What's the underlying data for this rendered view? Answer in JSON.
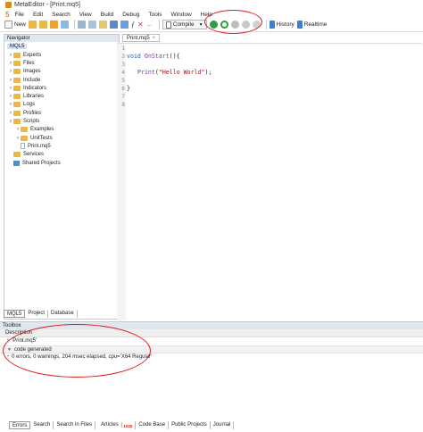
{
  "window": {
    "title": "MetaEditor - [Print.mq5]"
  },
  "menu": {
    "logo": "5",
    "items": [
      "File",
      "Edit",
      "Search",
      "View",
      "Build",
      "Debug",
      "Tools",
      "Window",
      "Help"
    ]
  },
  "toolbar": {
    "new_label": "New",
    "compile_label": "Compile",
    "history_label": "History",
    "realtime_label": "Realtime"
  },
  "navigator": {
    "title": "Navigator",
    "root": "MQL5",
    "items": [
      "Experts",
      "Files",
      "Images",
      "Include",
      "Indicators",
      "Libraries",
      "Logs",
      "Profiles",
      "Scripts",
      "Examples",
      "UnitTests",
      "Print.mq5",
      "Services",
      "Shared Projects"
    ],
    "tabs": [
      "MQL5",
      "Project",
      "Database"
    ]
  },
  "editor": {
    "tab": "Print.mq5",
    "line_numbers": [
      "1",
      "2",
      "3",
      "4",
      "5",
      "6",
      "7",
      "8"
    ],
    "code": {
      "kw": "void",
      "fn": "OnStart",
      "l2_rest": "(){",
      "print": "Print",
      "open": "(",
      "str": "\"Hello World\"",
      "close": ");",
      "brace": "}"
    }
  },
  "toolbox": {
    "title": "Toolbox",
    "header": "Description",
    "file": "'Print.mq5'",
    "group": "code generated",
    "result": "0 errors, 0 warnings, 204 msec elapsed, cpu='X64 Regular'",
    "tabs": [
      "Errors",
      "Search",
      "Search in Files",
      "Articles",
      "Code Base",
      "Public Projects",
      "Journal"
    ],
    "articles_badge": "1025"
  }
}
